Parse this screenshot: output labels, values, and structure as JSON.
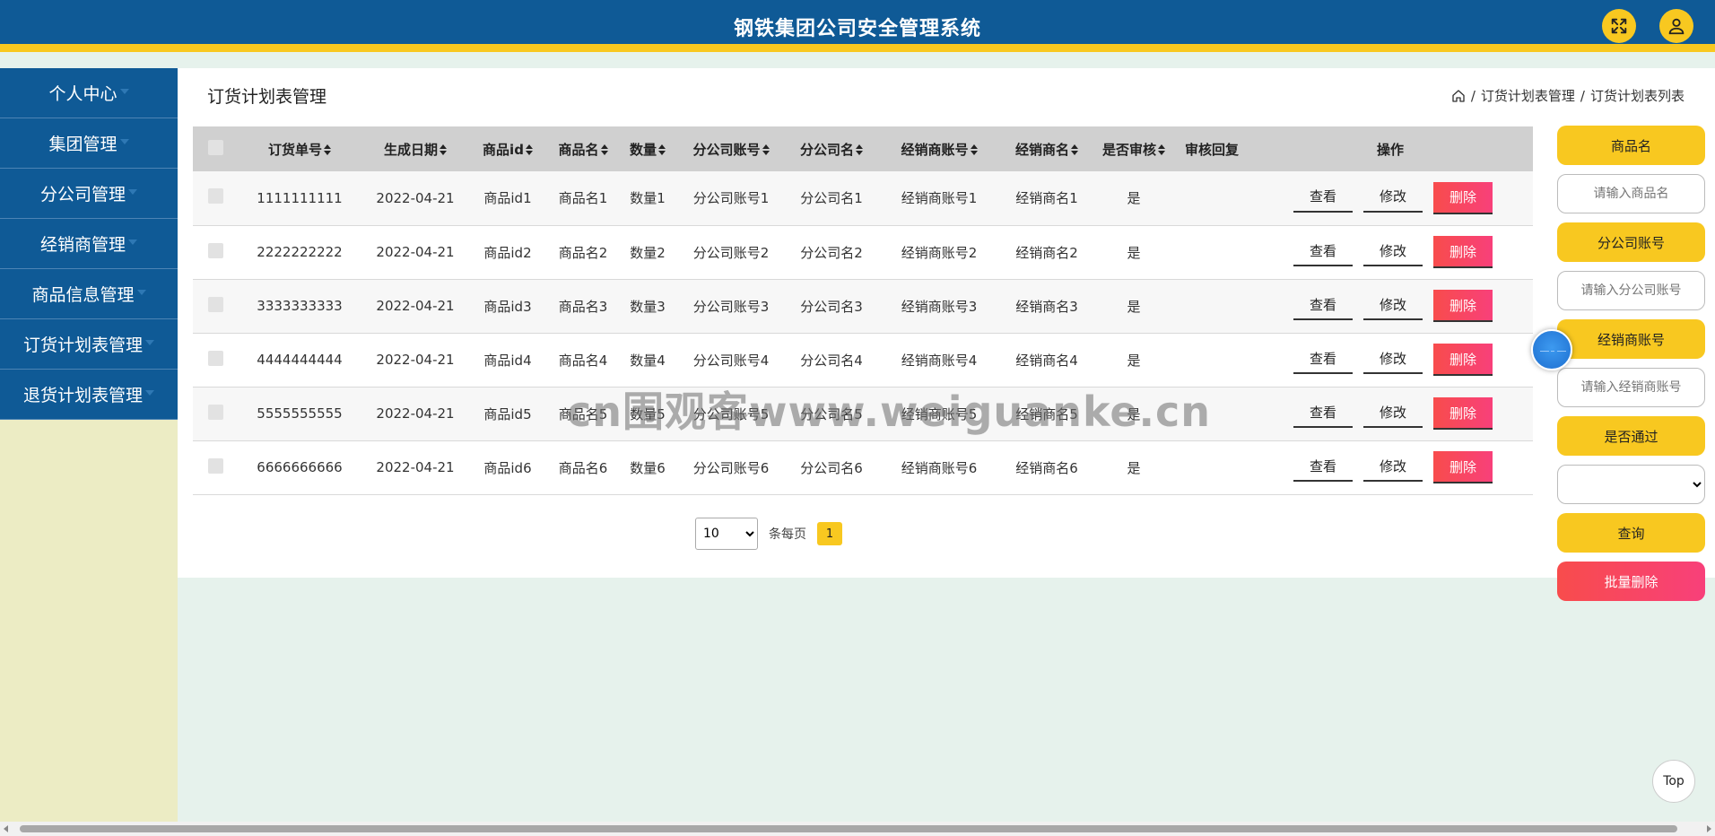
{
  "app": {
    "title": "钢铁集团公司安全管理系统"
  },
  "header": {
    "fullscreen_icon": "expand-arrows-icon",
    "user_icon": "user-icon"
  },
  "sidebar": {
    "items": [
      {
        "label": "个人中心"
      },
      {
        "label": "集团管理"
      },
      {
        "label": "分公司管理"
      },
      {
        "label": "经销商管理"
      },
      {
        "label": "商品信息管理"
      },
      {
        "label": "订货计划表管理"
      },
      {
        "label": "退货计划表管理"
      }
    ]
  },
  "page": {
    "title": "订货计划表管理",
    "breadcrumb": {
      "level1": "订货计划表管理",
      "level2": "订货计划表列表",
      "sep": "/"
    }
  },
  "table": {
    "headers": [
      "订货单号",
      "生成日期",
      "商品id",
      "商品名",
      "数量",
      "分公司账号",
      "分公司名",
      "经销商账号",
      "经销商名",
      "是否审核",
      "审核回复",
      "操作"
    ],
    "rows": [
      [
        "1111111111",
        "2022-04-21",
        "商品id1",
        "商品名1",
        "数量1",
        "分公司账号1",
        "分公司名1",
        "经销商账号1",
        "经销商名1",
        "是",
        ""
      ],
      [
        "2222222222",
        "2022-04-21",
        "商品id2",
        "商品名2",
        "数量2",
        "分公司账号2",
        "分公司名2",
        "经销商账号2",
        "经销商名2",
        "是",
        ""
      ],
      [
        "3333333333",
        "2022-04-21",
        "商品id3",
        "商品名3",
        "数量3",
        "分公司账号3",
        "分公司名3",
        "经销商账号3",
        "经销商名3",
        "是",
        ""
      ],
      [
        "4444444444",
        "2022-04-21",
        "商品id4",
        "商品名4",
        "数量4",
        "分公司账号4",
        "分公司名4",
        "经销商账号4",
        "经销商名4",
        "是",
        ""
      ],
      [
        "5555555555",
        "2022-04-21",
        "商品id5",
        "商品名5",
        "数量5",
        "分公司账号5",
        "分公司名5",
        "经销商账号5",
        "经销商名5",
        "是",
        ""
      ],
      [
        "6666666666",
        "2022-04-21",
        "商品id6",
        "商品名6",
        "数量6",
        "分公司账号6",
        "分公司名6",
        "经销商账号6",
        "经销商名6",
        "是",
        ""
      ]
    ],
    "actions": {
      "view": "查看",
      "edit": "修改",
      "delete": "删除"
    }
  },
  "pagination": {
    "page_size": "10",
    "page_size_suffix": "条每页",
    "current_page": "1"
  },
  "search": {
    "product_name_label": "商品名",
    "product_name_placeholder": "请输入商品名",
    "branch_account_label": "分公司账号",
    "branch_account_placeholder": "请输入分公司账号",
    "dealer_account_label": "经销商账号",
    "dealer_account_placeholder": "请输入经销商账号",
    "approved_label": "是否通过",
    "approved_value": "",
    "query_button": "查询",
    "batch_delete_button": "批量删除"
  },
  "floating": {
    "top_label": "Top"
  },
  "watermark": "cn围观客www.weiguanke.cn",
  "colors": {
    "header_bg": "#0f5a96",
    "accent_yellow": "#f8c820",
    "danger": "#f84c4c",
    "sidebar_bg": "#ececc4",
    "content_bg": "#e6f2ec"
  }
}
